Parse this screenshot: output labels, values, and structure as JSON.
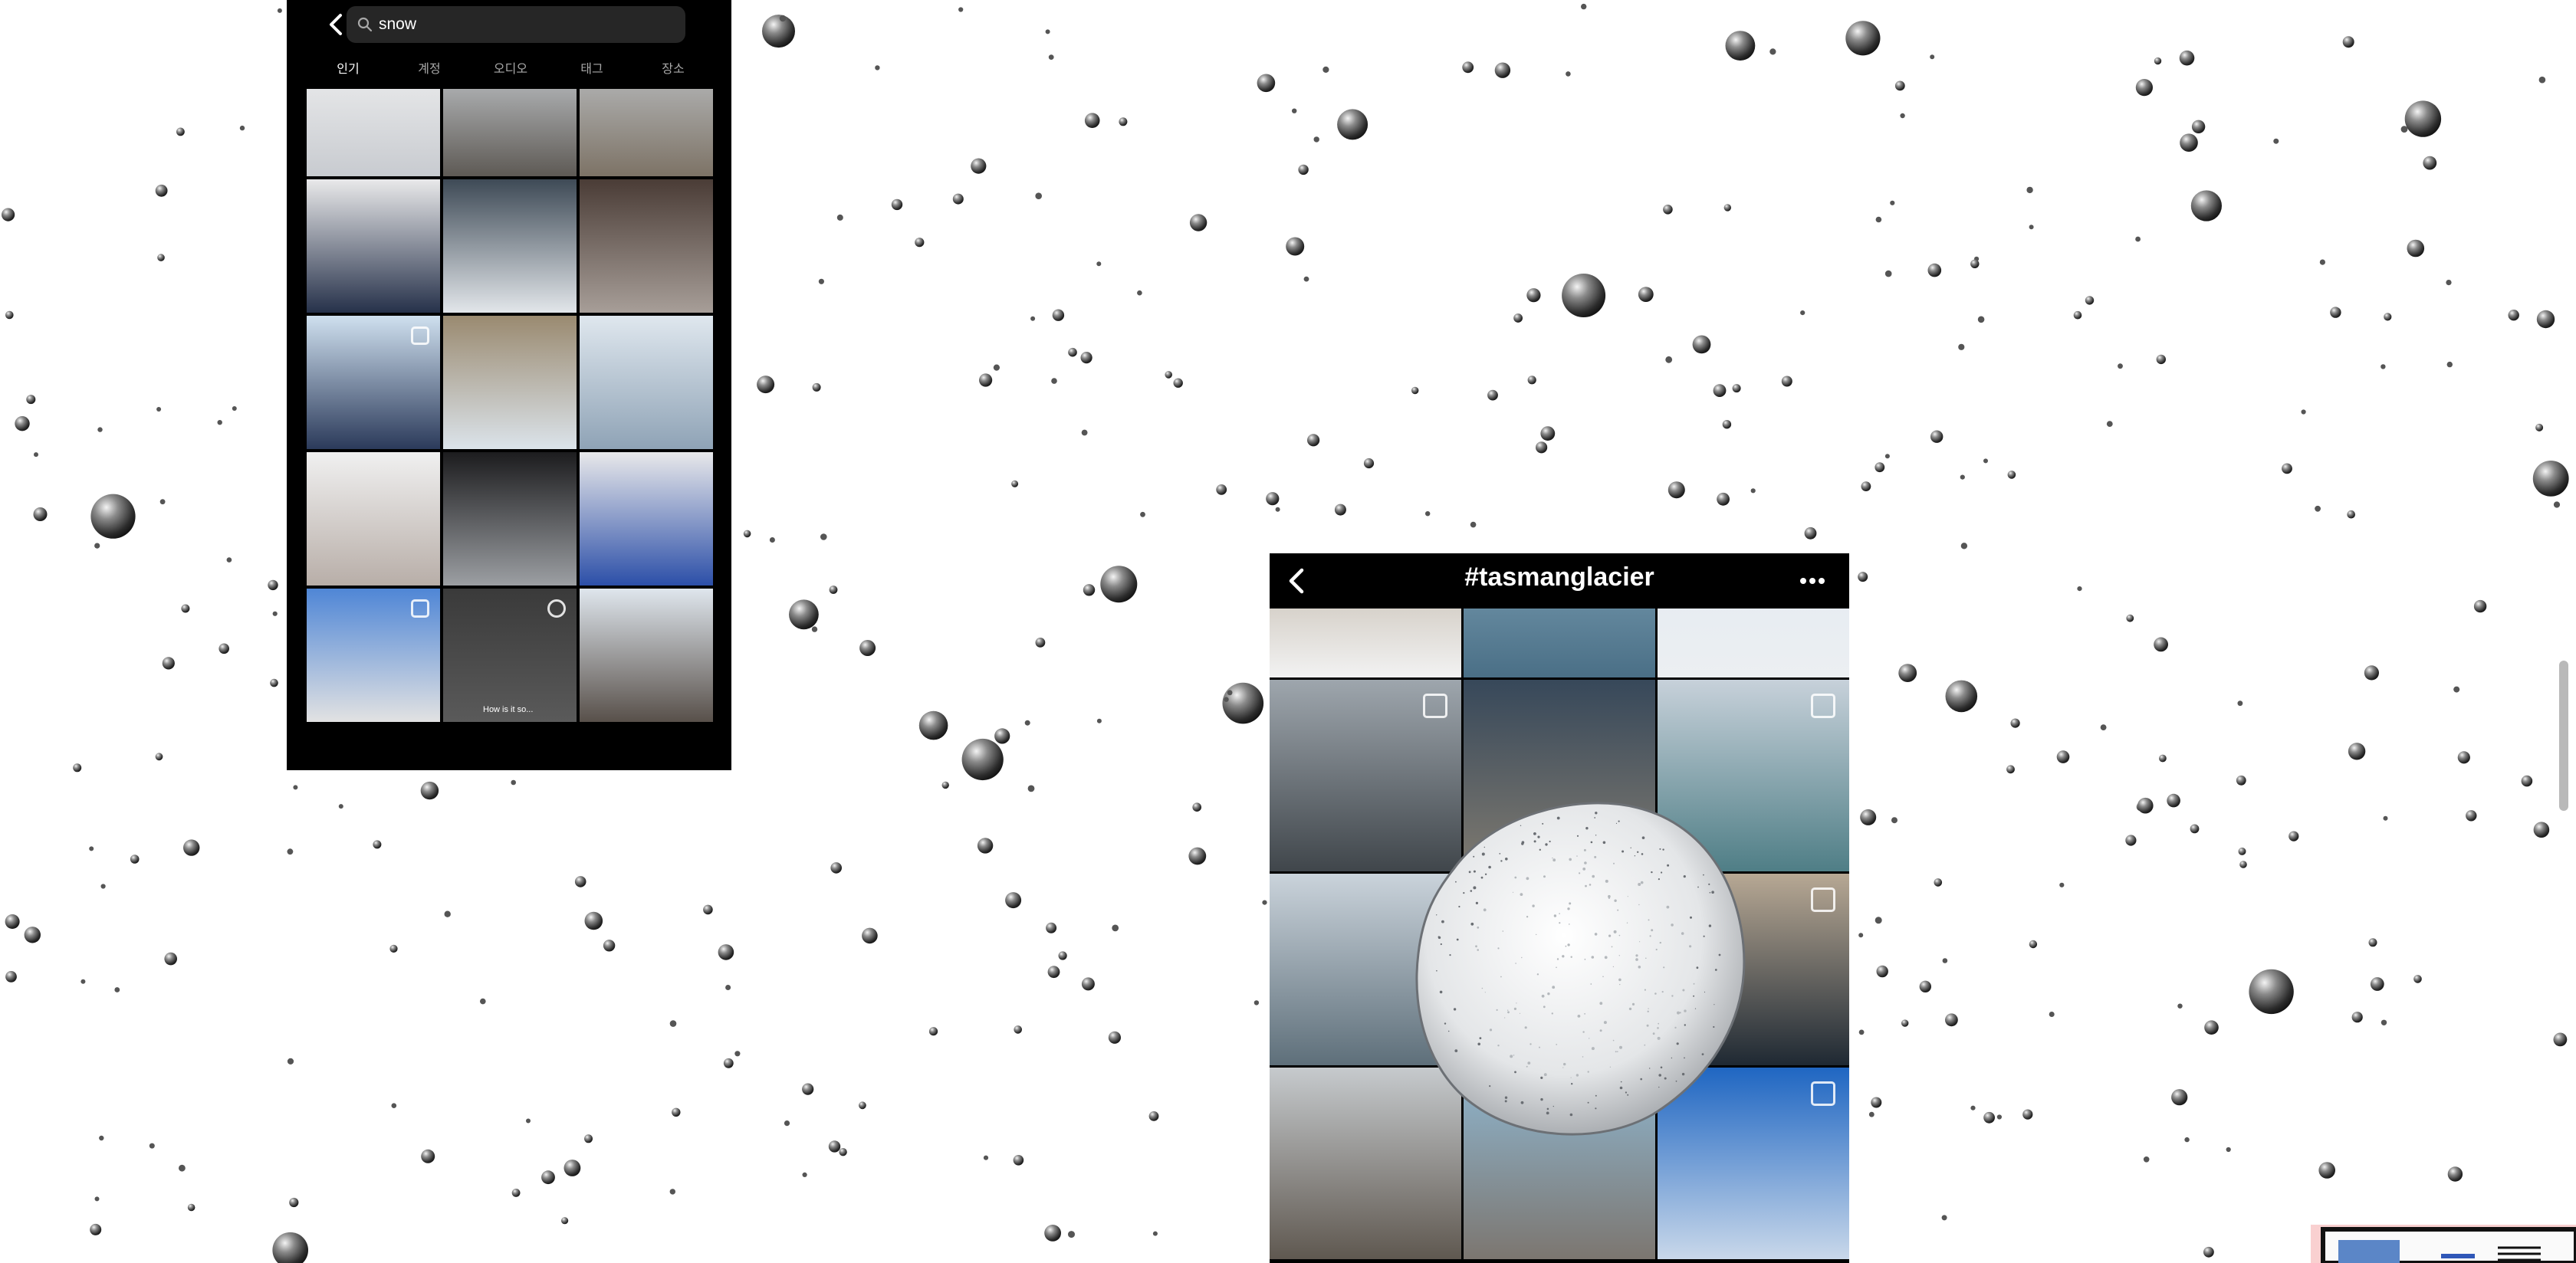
{
  "search_screen": {
    "query": "snow",
    "tabs": [
      {
        "label": "인기",
        "active": true
      },
      {
        "label": "계정",
        "active": false
      },
      {
        "label": "오디오",
        "active": false
      },
      {
        "label": "태그",
        "active": false
      },
      {
        "label": "장소",
        "active": false
      }
    ],
    "reel_caption": "How is it so...",
    "tiles": [
      {
        "name": "snowman",
        "top": "#f2f2f2",
        "bottom": "#c8cbd0",
        "multi": false,
        "reel": false
      },
      {
        "name": "woman-walking-snowy-path",
        "top": "#cfd4d9",
        "bottom": "#5e5a55",
        "multi": false,
        "reel": false
      },
      {
        "name": "snowy-park-trees",
        "top": "#c2c7cc",
        "bottom": "#7d7366",
        "multi": false,
        "reel": false
      },
      {
        "name": "woman-snow-portrait",
        "top": "#e9e9ea",
        "bottom": "#26314a",
        "multi": false,
        "reel": false
      },
      {
        "name": "snowy-forest",
        "top": "#3e4a56",
        "bottom": "#e2e6ea",
        "multi": false,
        "reel": false
      },
      {
        "name": "snowy-street-houses",
        "top": "#4a3c36",
        "bottom": "#a79e98",
        "multi": false,
        "reel": false
      },
      {
        "name": "woman-in-tent",
        "top": "#cfe0ef",
        "bottom": "#2b3a5a",
        "multi": true,
        "reel": false
      },
      {
        "name": "snowy-field-stream",
        "top": "#9a8a70",
        "bottom": "#dbe3ea",
        "multi": false,
        "reel": false
      },
      {
        "name": "woman-lying-in-snow",
        "top": "#dfe7ee",
        "bottom": "#8fa3b6",
        "multi": false,
        "reel": false
      },
      {
        "name": "toddler-in-snow",
        "top": "#f0f0f0",
        "bottom": "#b8aea8",
        "multi": false,
        "reel": false
      },
      {
        "name": "hooded-portrait",
        "top": "#1c1c1e",
        "bottom": "#9c9fa3",
        "multi": false,
        "reel": false
      },
      {
        "name": "woman-fur-hat",
        "top": "#e8e8ea",
        "bottom": "#2c4fa8",
        "multi": false,
        "reel": false
      },
      {
        "name": "woman-front-of-house",
        "top": "#4f86d6",
        "bottom": "#e2e2e2",
        "multi": true,
        "reel": false
      },
      {
        "name": "crowd-reel",
        "top": "#3a3a3a",
        "bottom": "#5a5a5a",
        "multi": false,
        "reel": true
      },
      {
        "name": "mountain-valley",
        "top": "#dfe6ed",
        "bottom": "#58504a",
        "multi": false,
        "reel": false
      }
    ]
  },
  "hashtag_screen": {
    "title": "#tasmanglacier",
    "tiles": [
      {
        "name": "hand-on-ice",
        "top": "#a89a86",
        "bottom": "#f2f2f2",
        "multi": false
      },
      {
        "name": "icebergs-aerial",
        "top": "#8fb2c6",
        "bottom": "#4a6f86",
        "multi": false
      },
      {
        "name": "helicopter-couple",
        "top": "#dfe8f1",
        "bottom": "#eceff2",
        "multi": false
      },
      {
        "name": "mountain-road-clouds",
        "top": "#9ea6ad",
        "bottom": "#40464b",
        "multi": true
      },
      {
        "name": "blue-iceberg",
        "top": "#37485a",
        "bottom": "#7f7a70",
        "multi": false
      },
      {
        "name": "glacier-lake-mountains",
        "top": "#c7d1da",
        "bottom": "#4f7e86",
        "multi": true
      },
      {
        "name": "couple-at-glacier-lake",
        "top": "#cad3db",
        "bottom": "#5e6f7a",
        "multi": false
      },
      {
        "name": "hidden-behind-snowball",
        "top": "#dadde0",
        "bottom": "#b9bcbf",
        "multi": false
      },
      {
        "name": "snowy-ridge-sunset",
        "top": "#b7a894",
        "bottom": "#1f2933",
        "multi": true
      },
      {
        "name": "road-into-mountains",
        "top": "#c6cacd",
        "bottom": "#5f5850",
        "multi": false
      },
      {
        "name": "person-on-lake-ice",
        "top": "#8fb6cf",
        "bottom": "#7c7670",
        "multi": false
      },
      {
        "name": "aoraki-mount-cook",
        "top": "#1f66c2",
        "bottom": "#c9d8ea",
        "multi": true
      }
    ]
  },
  "colors": {
    "phone_background": "#000000",
    "search_field": "#262626",
    "tab_inactive": "#a8a8a8",
    "snowflake_ball": "#4a4a4a"
  }
}
